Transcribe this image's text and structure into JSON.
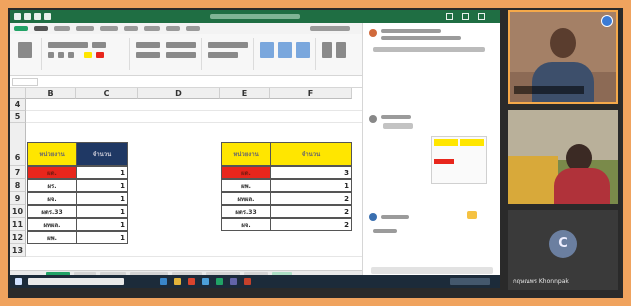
{
  "spreadsheet": {
    "columns": [
      "B",
      "C",
      "D",
      "E",
      "F"
    ],
    "rows": [
      "4",
      "5",
      "6",
      "7",
      "8",
      "9",
      "10",
      "11",
      "12",
      "13"
    ],
    "table_left": {
      "header_label": "หน่วยงาน",
      "header_count": "จำนวน",
      "rows": [
        {
          "label": "ผด.",
          "count": "1"
        },
        {
          "label": "ผร.",
          "count": "1"
        },
        {
          "label": "ผจ.",
          "count": "1"
        },
        {
          "label": "ผดร.33",
          "count": "1"
        },
        {
          "label": "ผทผล.",
          "count": "1"
        },
        {
          "label": "ผพ.",
          "count": "1"
        }
      ]
    },
    "table_right": {
      "header_label": "หน่วยงาน",
      "header_count": "จำนวน",
      "rows": [
        {
          "label": "ผด.",
          "count": "3"
        },
        {
          "label": "ผพ.",
          "count": "1"
        },
        {
          "label": "ผทผล.",
          "count": "2"
        },
        {
          "label": "ผดร.33",
          "count": "2"
        },
        {
          "label": "ผจ.",
          "count": "2"
        }
      ]
    },
    "colors": {
      "yellow": "#ffe600",
      "navy": "#1f3864",
      "red": "#e8261c",
      "excel_green": "#1f6e43"
    }
  },
  "participants": {
    "tile3_initial": "C",
    "tile3_name": "กฤษณพร Khonnpak"
  },
  "icons": [
    "windows-icon",
    "search-icon",
    "excel-icon",
    "chrome-icon",
    "folder-icon",
    "teams-icon"
  ]
}
